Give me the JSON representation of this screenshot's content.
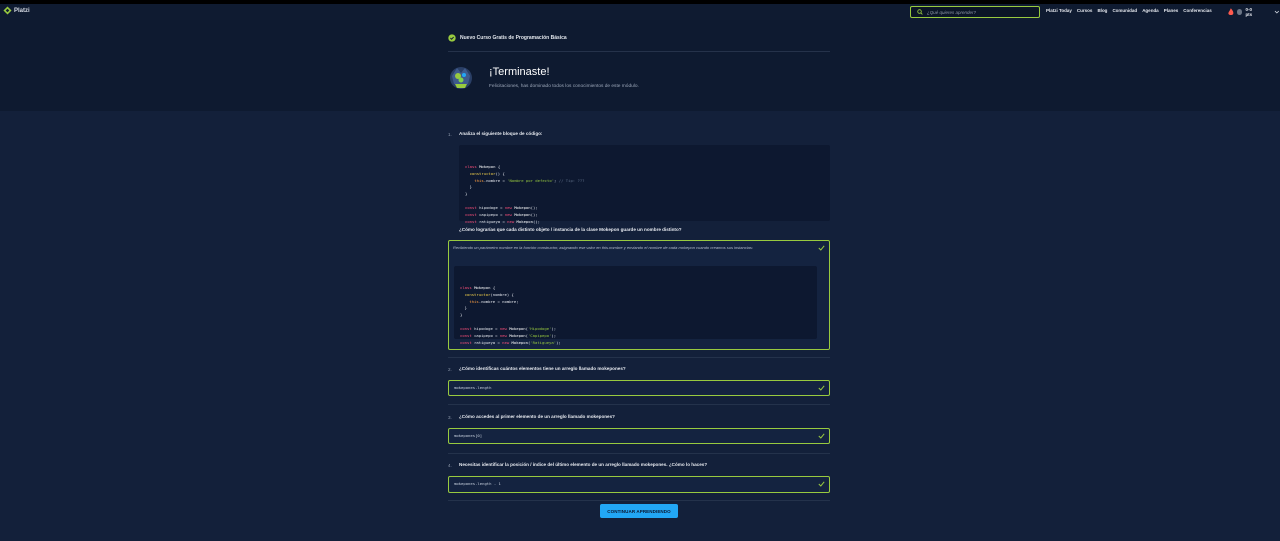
{
  "navbar": {
    "logo_text": "Platzi",
    "search_placeholder": "¿Qué quieres aprender?",
    "links": [
      "Platzi Today",
      "Cursos",
      "Blog",
      "Comunidad",
      "Agenda",
      "Planes",
      "Conferencias"
    ],
    "user_name": "0-0 pts"
  },
  "header": {
    "course_title": "Nuevo Curso Gratis de Programación Básica",
    "finish_title": "¡Terminaste!",
    "finish_subtitle": "Felicitaciones, has dominado todos los conocimientos de este módulo."
  },
  "questions": [
    {
      "number": "1.",
      "prompt": "Analiza el siguiente bloque de código:",
      "code": [
        [
          [
            "kw",
            "class "
          ],
          [
            "cls",
            "Mokepon "
          ],
          [
            "pr",
            "{"
          ]
        ],
        [
          [
            "pr",
            "  "
          ],
          [
            "fn",
            "constructor"
          ],
          [
            "pr",
            "() {"
          ]
        ],
        [
          [
            "pr",
            "    "
          ],
          [
            "th",
            "this"
          ],
          [
            "pr",
            ".nombre = "
          ],
          [
            "st",
            "'Nombre por defecto'"
          ],
          [
            "pr",
            "; "
          ],
          [
            "cm",
            "// Tip: ???"
          ]
        ],
        [
          [
            "pr",
            "  }"
          ]
        ],
        [
          [
            "pr",
            "}"
          ]
        ],
        [
          [
            "pr",
            " "
          ]
        ],
        [
          [
            "kw",
            "const "
          ],
          [
            "pr",
            "hipodoge = "
          ],
          [
            "kw",
            "new "
          ],
          [
            "cls",
            "Mokepon"
          ],
          [
            "pr",
            "();"
          ]
        ],
        [
          [
            "kw",
            "const "
          ],
          [
            "pr",
            "capipepo = "
          ],
          [
            "kw",
            "new "
          ],
          [
            "cls",
            "Mokepon"
          ],
          [
            "pr",
            "();"
          ]
        ],
        [
          [
            "kw",
            "const "
          ],
          [
            "pr",
            "ratigueya = "
          ],
          [
            "kw",
            "new "
          ],
          [
            "cls",
            "Mokepon"
          ],
          [
            "pr",
            "();"
          ]
        ]
      ],
      "sub_prompt": "¿Cómo lograrías que cada distinto objeto / instancia de la clase Mokepon guarde un nombre distinto?",
      "answer_text": "Recibiendo un parámetro nombre en la función constructor, asignando ese valor en this.nombre y enviando el nombre de cada mokepon cuando creamos sus instancias:",
      "answer_code": [
        [
          [
            "kw",
            "class "
          ],
          [
            "cls",
            "Mokepon "
          ],
          [
            "pr",
            "{"
          ]
        ],
        [
          [
            "pr",
            "  "
          ],
          [
            "fn",
            "constructor"
          ],
          [
            "pr",
            "(nombre) {"
          ]
        ],
        [
          [
            "pr",
            "    "
          ],
          [
            "th",
            "this"
          ],
          [
            "pr",
            ".nombre = nombre;"
          ]
        ],
        [
          [
            "pr",
            "  }"
          ]
        ],
        [
          [
            "pr",
            "}"
          ]
        ],
        [
          [
            "pr",
            " "
          ]
        ],
        [
          [
            "kw",
            "const "
          ],
          [
            "pr",
            "hipodoge = "
          ],
          [
            "kw",
            "new "
          ],
          [
            "cls",
            "Mokepon"
          ],
          [
            "pr",
            "("
          ],
          [
            "st",
            "'Hipodoge'"
          ],
          [
            "pr",
            ");"
          ]
        ],
        [
          [
            "kw",
            "const "
          ],
          [
            "pr",
            "capipepo = "
          ],
          [
            "kw",
            "new "
          ],
          [
            "cls",
            "Mokepon"
          ],
          [
            "pr",
            "("
          ],
          [
            "st",
            "'Capipepo'"
          ],
          [
            "pr",
            ");"
          ]
        ],
        [
          [
            "kw",
            "const "
          ],
          [
            "pr",
            "ratigueya = "
          ],
          [
            "kw",
            "new "
          ],
          [
            "cls",
            "Mokepon"
          ],
          [
            "pr",
            "("
          ],
          [
            "st",
            "'Ratigueya'"
          ],
          [
            "pr",
            ");"
          ]
        ]
      ]
    },
    {
      "number": "2.",
      "prompt": "¿Cómo identificas cuántos elementos tiene un arreglo llamado mokepones?",
      "answer": "mokepones.length"
    },
    {
      "number": "3.",
      "prompt": "¿Cómo accedes al primer elemento de un arreglo llamado mokepones?",
      "answer": "mokepones[0]"
    },
    {
      "number": "4.",
      "prompt": "Necesitas identificar la posición / índice del último elemento de un arreglo llamado mokepones. ¿Cómo lo haces?",
      "answer": "mokepones.length - 1"
    }
  ],
  "continue_label": "CONTINUAR APRENDIENDO",
  "colors": {
    "accent": "#98ca3f",
    "button": "#22a7f5",
    "background": "#13203a",
    "header": "#0e1a30"
  }
}
